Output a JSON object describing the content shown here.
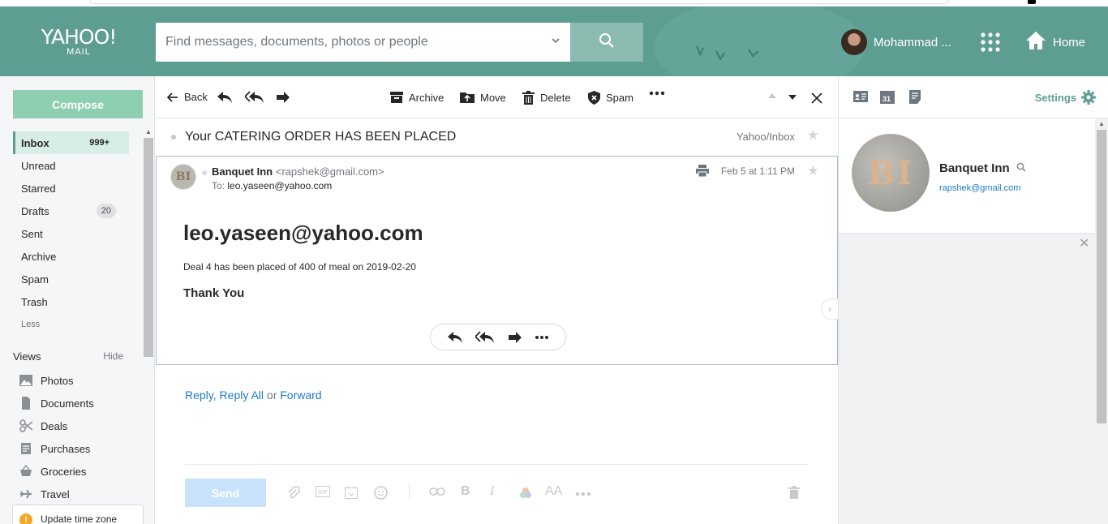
{
  "header": {
    "logo_line1": "YAHOO!",
    "logo_line2": "MAIL",
    "search_placeholder": "Find messages, documents, photos or people",
    "user_name": "Mohammad ...",
    "home_label": "Home"
  },
  "sidebar": {
    "compose_label": "Compose",
    "folders": [
      {
        "label": "Inbox",
        "count": "999+"
      },
      {
        "label": "Unread"
      },
      {
        "label": "Starred"
      },
      {
        "label": "Drafts",
        "count": "20"
      },
      {
        "label": "Sent"
      },
      {
        "label": "Archive"
      },
      {
        "label": "Spam"
      },
      {
        "label": "Trash"
      },
      {
        "label": "Less"
      }
    ],
    "views_title": "Views",
    "views_hide": "Hide",
    "views": [
      {
        "label": "Photos",
        "icon": "photo-icon"
      },
      {
        "label": "Documents",
        "icon": "document-icon"
      },
      {
        "label": "Deals",
        "icon": "scissors-icon"
      },
      {
        "label": "Purchases",
        "icon": "receipt-icon"
      },
      {
        "label": "Groceries",
        "icon": "basket-icon"
      },
      {
        "label": "Travel",
        "icon": "plane-icon"
      }
    ],
    "timezone_label": "Update time zone"
  },
  "toolbar": {
    "back": "Back",
    "archive": "Archive",
    "move": "Move",
    "delete": "Delete",
    "spam": "Spam"
  },
  "message": {
    "subject": "Your CATERING ORDER HAS BEEN PLACED",
    "folder_path": "Yahoo/Inbox",
    "sender_name": "Banquet Inn",
    "sender_email": "<rapshek@gmail.com>",
    "to_label": "To:",
    "to_address": "leo.yaseen@yahoo.com",
    "date": "Feb 5 at 1:11 PM",
    "avatar_initials": "BI",
    "body_heading": "leo.yaseen@yahoo.com",
    "body_text": "Deal 4 has been placed of 400 of meal on 2019-02-20",
    "body_signoff": "Thank You"
  },
  "reply": {
    "reply": "Reply",
    "comma": ",",
    "reply_all": "Reply All",
    "or": "or",
    "forward": "Forward",
    "send_label": "Send"
  },
  "right_panel": {
    "settings_label": "Settings",
    "calendar_day": "31",
    "contact_name": "Banquet Inn",
    "contact_email": "rapshek@gmail.com",
    "contact_initials": "BI"
  },
  "colors": {
    "header_bg": "#5e9e92",
    "compose_bg": "#8dcfb0",
    "link": "#1d7bcb",
    "accent": "#5e9e92"
  }
}
